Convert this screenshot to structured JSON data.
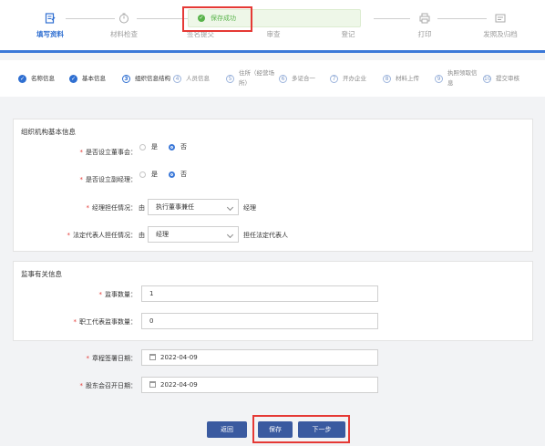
{
  "top_steps": [
    {
      "label": "填写资料",
      "icon": "edit-form-icon",
      "active": true
    },
    {
      "label": "材料检查",
      "icon": "timer-icon",
      "active": false
    },
    {
      "label": "签名提交",
      "icon": "sign-icon",
      "active": false
    },
    {
      "label": "审查",
      "icon": "review-icon",
      "active": false
    },
    {
      "label": "登记",
      "icon": "register-icon",
      "active": false
    },
    {
      "label": "打印",
      "icon": "printer-icon",
      "active": false
    },
    {
      "label": "发照及归档",
      "icon": "archive-icon",
      "active": false
    }
  ],
  "toast": {
    "text": "保存成功"
  },
  "sub_steps": [
    {
      "marker": "✓",
      "label": "名称信息",
      "state": "done"
    },
    {
      "marker": "✓",
      "label": "基本信息",
      "state": "done"
    },
    {
      "marker": "3",
      "label": "组织信息结构",
      "state": "current"
    },
    {
      "marker": "4",
      "label": "人员信息",
      "state": "todo"
    },
    {
      "marker": "5",
      "label": "住所（经营场所）",
      "state": "todo"
    },
    {
      "marker": "6",
      "label": "多证合一",
      "state": "todo"
    },
    {
      "marker": "7",
      "label": "开办企业",
      "state": "todo"
    },
    {
      "marker": "8",
      "label": "材料上传",
      "state": "todo"
    },
    {
      "marker": "9",
      "label": "执照领取信息",
      "state": "todo"
    },
    {
      "marker": "10",
      "label": "提交审核",
      "state": "todo"
    }
  ],
  "org_section": {
    "title": "组织机构基本信息",
    "board": {
      "label": "是否设立董事会：",
      "opt_yes": "是",
      "opt_no": "否",
      "selected": "否"
    },
    "vice_manager": {
      "label": "是否设立副经理：",
      "opt_yes": "是",
      "opt_no": "否",
      "selected": "否"
    },
    "manager": {
      "label": "经理担任情况：",
      "prefix": "由",
      "value": "执行董事兼任",
      "suffix": "经理"
    },
    "legal_rep": {
      "label": "法定代表人担任情况：",
      "prefix": "由",
      "value": "经理",
      "suffix": "担任法定代表人"
    }
  },
  "supervisor_section": {
    "title": "监事有关信息",
    "count": {
      "label": "监事数量：",
      "value": "1"
    },
    "staff_count": {
      "label": "职工代表监事数量：",
      "value": "0"
    }
  },
  "dates": {
    "charter": {
      "label": "章程签署日期：",
      "value": "2022-04-09"
    },
    "meeting": {
      "label": "股东会召开日期：",
      "value": "2022-04-09"
    }
  },
  "buttons": {
    "back": "返回",
    "save": "保存",
    "next": "下一步"
  },
  "colors": {
    "primary": "#2f6fd1",
    "button": "#3a5aa0",
    "success": "#58b34a",
    "required": "#e53935",
    "highlight_box": "#e53935"
  }
}
